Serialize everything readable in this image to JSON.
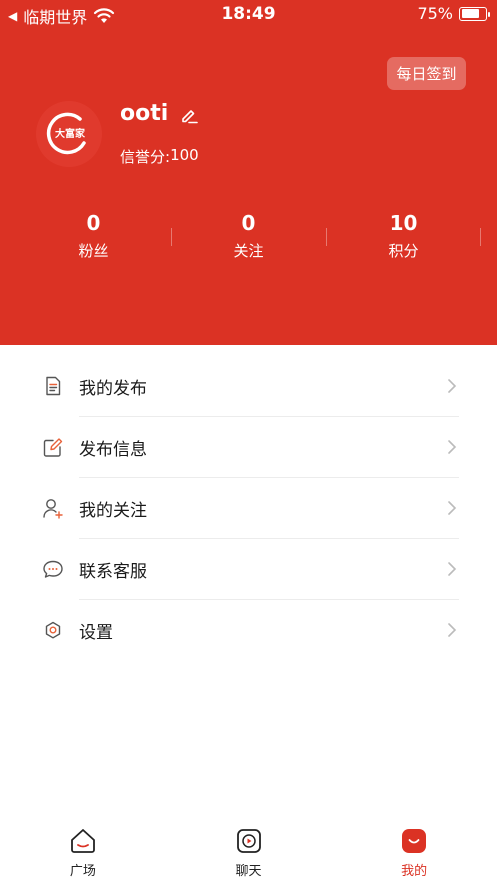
{
  "status_bar": {
    "back_label": "临期世界",
    "time": "18:49",
    "battery_percent": "75%",
    "battery_level": 0.75
  },
  "header": {
    "checkin_label": "每日签到",
    "username": "ooti",
    "credit_label": "信誉分:",
    "credit_value": "100",
    "avatar_text": "大富家"
  },
  "stats": [
    {
      "value": "0",
      "label": "粉丝"
    },
    {
      "value": "0",
      "label": "关注"
    },
    {
      "value": "10",
      "label": "积分"
    }
  ],
  "menu": [
    {
      "label": "我的发布",
      "icon": "document-icon"
    },
    {
      "label": "发布信息",
      "icon": "edit-square-icon"
    },
    {
      "label": "我的关注",
      "icon": "user-add-icon"
    },
    {
      "label": "联系客服",
      "icon": "chat-bubble-icon"
    },
    {
      "label": "设置",
      "icon": "gear-icon"
    }
  ],
  "tabs": [
    {
      "label": "广场",
      "icon": "home-icon",
      "active": false
    },
    {
      "label": "聊天",
      "icon": "play-chat-icon",
      "active": false
    },
    {
      "label": "我的",
      "icon": "profile-smile-icon",
      "active": true
    }
  ],
  "colors": {
    "brand": "#db3224",
    "text": "#1a1a1a",
    "icon_gray": "#555555",
    "accent_orange": "#e8623a"
  }
}
